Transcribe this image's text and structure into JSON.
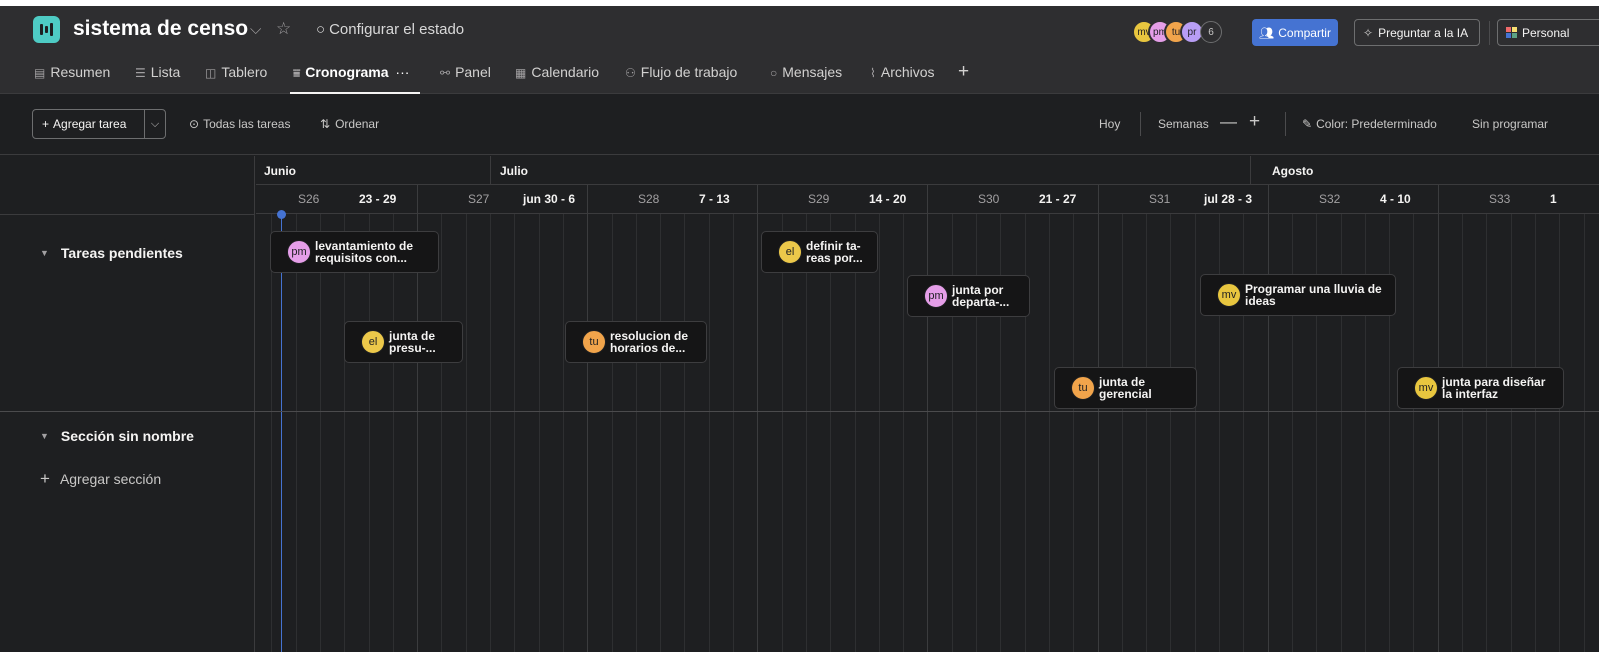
{
  "project": {
    "title": "sistema de censo",
    "status_label": "Configurar el estado",
    "icon": "board-icon"
  },
  "header_actions": {
    "share_label": "Compartir",
    "ask_ai_label": "Preguntar a la IA",
    "customize_label": "Personal",
    "members": [
      {
        "initials": "mv",
        "color": "#e8c63f"
      },
      {
        "initials": "pm",
        "color": "#e59ee8"
      },
      {
        "initials": "tu",
        "color": "#f1a44b"
      },
      {
        "initials": "pr",
        "color": "#b89ef5"
      }
    ],
    "member_count": "6"
  },
  "tabs": [
    {
      "label": "Resumen",
      "icon": "document-icon"
    },
    {
      "label": "Lista",
      "icon": "list-icon"
    },
    {
      "label": "Tablero",
      "icon": "board-icon"
    },
    {
      "label": "Cronograma",
      "icon": "timeline-icon",
      "active": true,
      "more": "···"
    },
    {
      "label": "Panel",
      "icon": "chart-icon"
    },
    {
      "label": "Calendario",
      "icon": "calendar-icon"
    },
    {
      "label": "Flujo de trabajo",
      "icon": "workflow-icon"
    },
    {
      "label": "Mensajes",
      "icon": "message-icon"
    },
    {
      "label": "Archivos",
      "icon": "paperclip-icon"
    }
  ],
  "add_tab": "+",
  "toolbar": {
    "add_task_label": "Agregar tarea",
    "all_tasks_label": "Todas las tareas",
    "sort_label": "Ordenar",
    "today_label": "Hoy",
    "zoom_label": "Semanas",
    "color_label": "Color: Predeterminado",
    "unscheduled_label": "Sin programar"
  },
  "timeline": {
    "months": [
      "Junio",
      "Julio",
      "Agosto"
    ],
    "weeks": [
      {
        "label": "S26",
        "range": "23 - 29"
      },
      {
        "label": "S27",
        "range": "jun 30 - 6"
      },
      {
        "label": "S28",
        "range": "7 - 13"
      },
      {
        "label": "S29",
        "range": "14 - 20"
      },
      {
        "label": "S30",
        "range": "21 - 27"
      },
      {
        "label": "S31",
        "range": "jul 28 - 3"
      },
      {
        "label": "S32",
        "range": "4 - 10"
      },
      {
        "label": "S33",
        "range": "1"
      }
    ]
  },
  "sections": [
    {
      "title": "Tareas pendientes"
    },
    {
      "title": "Sección sin nombre"
    }
  ],
  "add_section_label": "Agregar sección",
  "tasks": [
    {
      "name": "levantamiento de\nrequisitos con...",
      "assignee": "pm",
      "color": "#e59ee8"
    },
    {
      "name": "junta de\npresu-...",
      "assignee": "el",
      "color": "#ecc84a"
    },
    {
      "name": "resolucion de\nhorarios de...",
      "assignee": "tu",
      "color": "#f1a44b"
    },
    {
      "name": "definir ta-\nreas por...",
      "assignee": "el",
      "color": "#ecc84a"
    },
    {
      "name": "junta por\ndeparta-...",
      "assignee": "pm",
      "color": "#e59ee8"
    },
    {
      "name": "junta de\ngerencial",
      "assignee": "tu",
      "color": "#f1a44b"
    },
    {
      "name": "Programar una lluvia de\nideas",
      "assignee": "mv",
      "color": "#e8c63f"
    },
    {
      "name": "junta para diseñar\nla interfaz",
      "assignee": "mv",
      "color": "#e8c63f"
    }
  ]
}
